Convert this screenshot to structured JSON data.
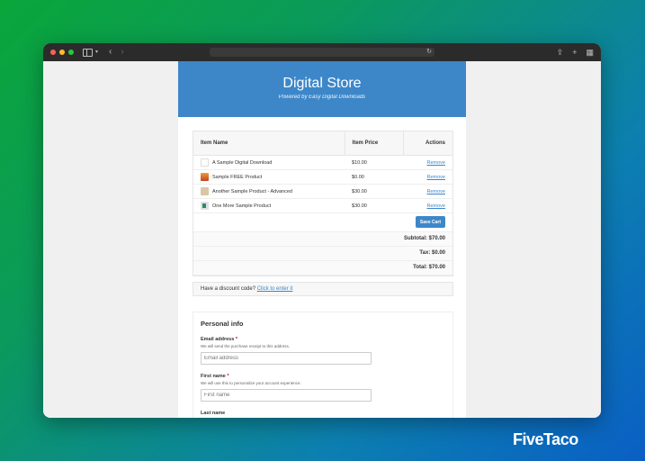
{
  "store": {
    "title": "Digital Store",
    "subtitle": "Powered by Easy Digital Downloads"
  },
  "cart": {
    "headers": {
      "name": "Item Name",
      "price": "Item Price",
      "actions": "Actions"
    },
    "items": [
      {
        "name": "A Sample Digital Download",
        "price": "$10.00",
        "remove": "Remove"
      },
      {
        "name": "Sample FREE Product",
        "price": "$0.00",
        "remove": "Remove"
      },
      {
        "name": "Another Sample Product - Advanced",
        "price": "$30.00",
        "remove": "Remove"
      },
      {
        "name": "One More Sample Product",
        "price": "$30.00",
        "remove": "Remove"
      }
    ],
    "save_label": "Save Cart",
    "subtotal": "Subtotal: $70.00",
    "tax": "Tax: $0.00",
    "total": "Total: $70.00"
  },
  "discount": {
    "prompt": "Have a discount code?",
    "link": "Click to enter it"
  },
  "personal": {
    "title": "Personal info",
    "email_label": "Email address",
    "email_desc": "We will send the purchase receipt to this address.",
    "email_placeholder": "Email address",
    "first_label": "First name",
    "first_desc": "We will use this to personalize your account experience.",
    "first_placeholder": "First name",
    "last_label": "Last name",
    "required_mark": "*"
  },
  "brand": {
    "logo": "FiveTaco"
  }
}
